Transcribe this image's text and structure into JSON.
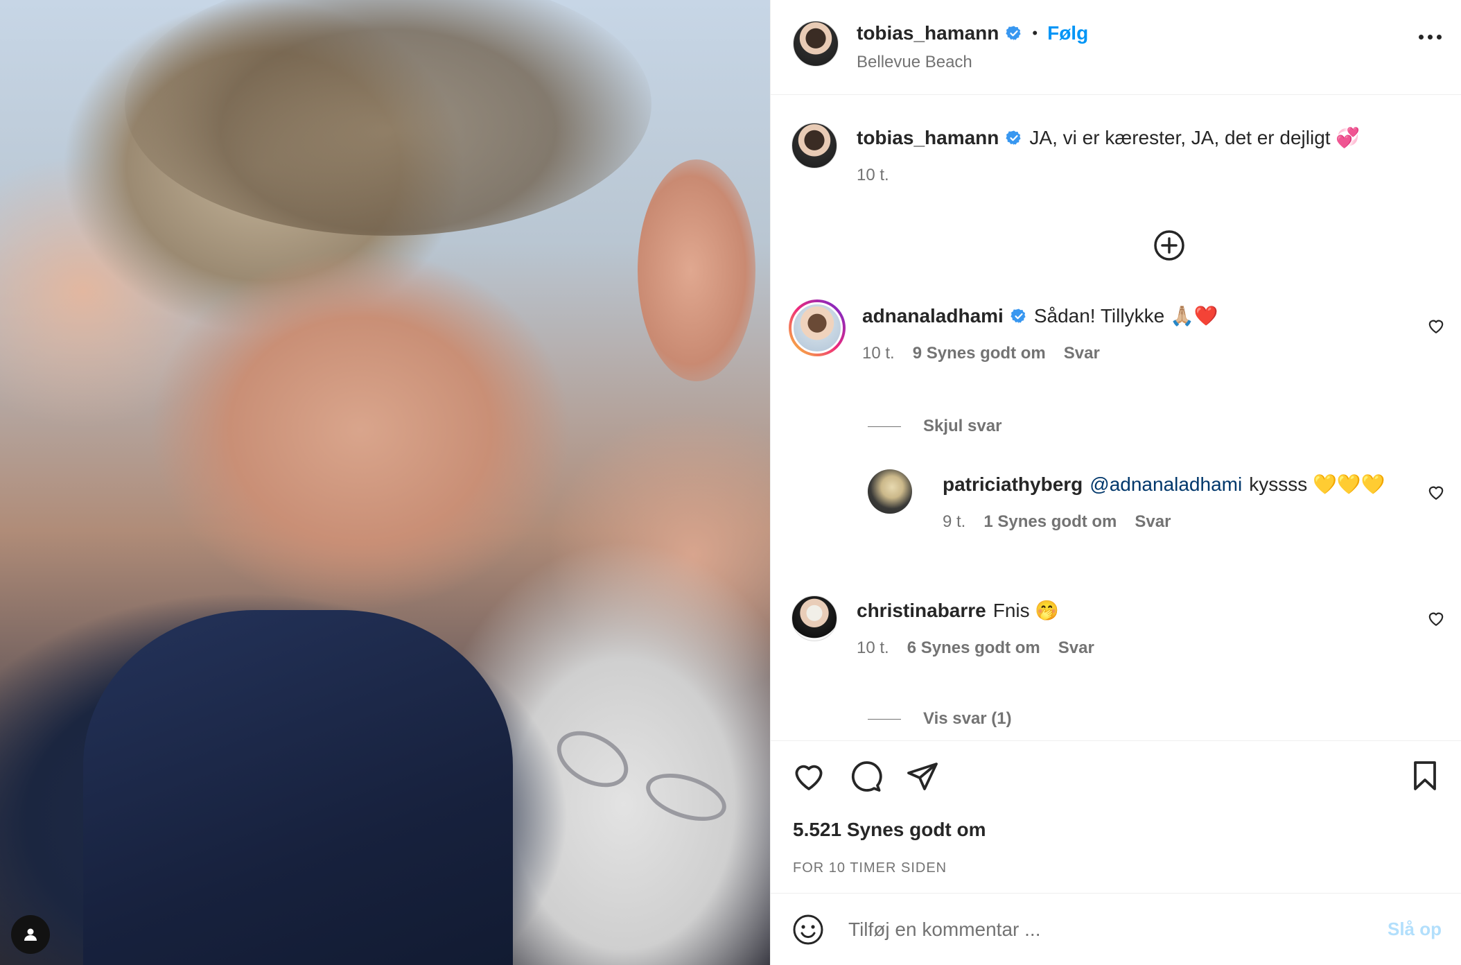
{
  "post": {
    "author": "tobias_hamann",
    "follow_label": "Følg",
    "location": "Bellevue Beach",
    "caption": "JA, vi er kærester, JA, det er dejligt 💞",
    "caption_time": "10 t."
  },
  "comments": [
    {
      "user": "adnanaladhami",
      "verified": true,
      "text": "Sådan! Tillykke 🙏🏼❤️",
      "time": "10 t.",
      "likes": "9 Synes godt om",
      "reply_label": "Svar",
      "thread_toggle": "Skjul svar",
      "replies": [
        {
          "user": "patriciathyberg",
          "mention": "@adnanaladhami",
          "text": "kyssss 💛💛💛",
          "time": "9 t.",
          "likes": "1 Synes godt om",
          "reply_label": "Svar"
        }
      ]
    },
    {
      "user": "christinabarre",
      "verified": false,
      "text": "Fnis 🤭",
      "time": "10 t.",
      "likes": "6 Synes godt om",
      "reply_label": "Svar",
      "thread_toggle": "Vis svar (1)"
    }
  ],
  "footer": {
    "likes": "5.521 Synes godt om",
    "time_ago": "FOR 10 TIMER SIDEN",
    "comment_placeholder": "Tilføj en kommentar ...",
    "post_label": "Slå op"
  },
  "colors": {
    "accent": "#0095f6",
    "text": "#262626",
    "secondary": "#737373",
    "border": "#efefef",
    "verified": "#3897f0"
  },
  "icons": [
    "user-tag-icon",
    "verified-icon",
    "more-options-icon",
    "load-more-icon",
    "heart-icon",
    "comment-icon",
    "share-icon",
    "bookmark-icon",
    "emoji-icon"
  ]
}
